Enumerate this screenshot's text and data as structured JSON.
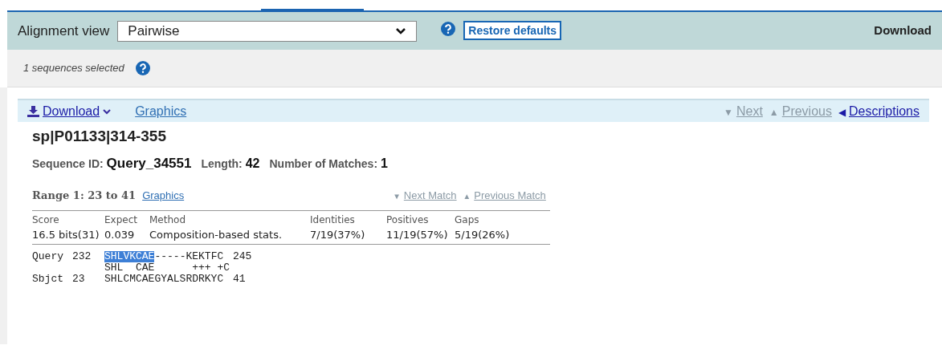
{
  "toolbar": {
    "view_label": "Alignment view",
    "view_value": "Pairwise",
    "restore": "Restore defaults",
    "download": "Download"
  },
  "selection": {
    "text": "1 sequences selected"
  },
  "result": {
    "nav_left": [
      {
        "kind": "download",
        "label": "Download"
      },
      {
        "kind": "link",
        "label": "Graphics"
      }
    ],
    "nav_right": [
      {
        "arrow": "▼",
        "label": "Next",
        "disabled": true
      },
      {
        "arrow": "▲",
        "label": "Previous",
        "disabled": true
      },
      {
        "arrow": "◀",
        "label": "Descriptions",
        "disabled": false
      }
    ],
    "title": "sp|P01133|314-355",
    "meta": [
      {
        "label": "Sequence ID:",
        "value": "Query_34551"
      },
      {
        "label": "Length:",
        "value": "42"
      },
      {
        "label": "Number of Matches:",
        "value": "1"
      }
    ],
    "range": {
      "label": "Range 1: 23 to 41",
      "link": "Graphics",
      "match_nav": [
        {
          "arrow": "▼",
          "label": "Next Match",
          "disabled": true
        },
        {
          "arrow": "▲",
          "label": "Previous Match",
          "disabled": true
        }
      ]
    },
    "stats": {
      "columns": [
        "Score",
        "Expect",
        "Method",
        "Identities",
        "Positives",
        "Gaps"
      ],
      "values": [
        "16.5 bits(31)",
        "0.039",
        "Composition-based stats.",
        "7/19(37%)",
        "11/19(57%)",
        "5/19(26%)"
      ]
    },
    "alignment": [
      {
        "label": "Query",
        "start": "232",
        "parts": [
          {
            "text": "SHLVKCAE",
            "selected": true
          },
          {
            "text": "-----KEKTFC",
            "selected": false
          }
        ],
        "end": "245"
      },
      {
        "parts": [
          {
            "text": "SHL  CAE      +++ +C",
            "selected": false
          }
        ]
      },
      {
        "label": "Sbjct",
        "start": "23",
        "parts": [
          {
            "text": "SHLCMCAEGYALSRDRKYC",
            "selected": false
          }
        ],
        "end": "41"
      }
    ]
  }
}
